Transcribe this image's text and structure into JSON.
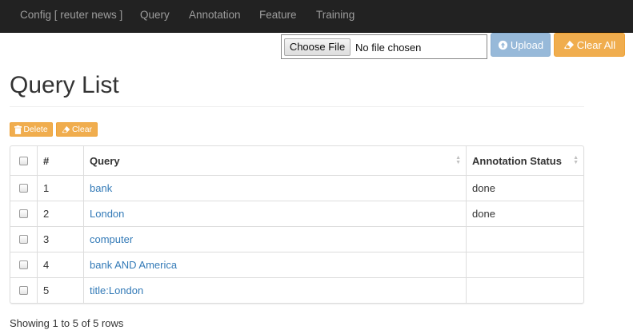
{
  "navbar": {
    "items": [
      {
        "label": "Config [ reuter news ]"
      },
      {
        "label": "Query"
      },
      {
        "label": "Annotation"
      },
      {
        "label": "Feature"
      },
      {
        "label": "Training"
      }
    ]
  },
  "upload": {
    "choose_file_label": "Choose File",
    "file_status": "No file chosen",
    "upload_label": "Upload",
    "clear_all_label": "Clear All"
  },
  "page": {
    "title": "Query List"
  },
  "toolbar": {
    "delete_label": "Delete",
    "clear_label": "Clear"
  },
  "table": {
    "columns": {
      "number": "#",
      "query": "Query",
      "status": "Annotation Status"
    },
    "rows": [
      {
        "number": "1",
        "query": "bank",
        "status": "done"
      },
      {
        "number": "2",
        "query": "London",
        "status": "done"
      },
      {
        "number": "3",
        "query": "computer",
        "status": ""
      },
      {
        "number": "4",
        "query": "bank AND America",
        "status": ""
      },
      {
        "number": "5",
        "query": "title:London",
        "status": ""
      }
    ]
  },
  "footer": {
    "summary": "Showing 1 to 5 of 5 rows"
  },
  "colors": {
    "navbar_bg": "#222222",
    "link": "#337ab7",
    "warning": "#f0ad4e",
    "primary_disabled": "#97b9d9"
  }
}
